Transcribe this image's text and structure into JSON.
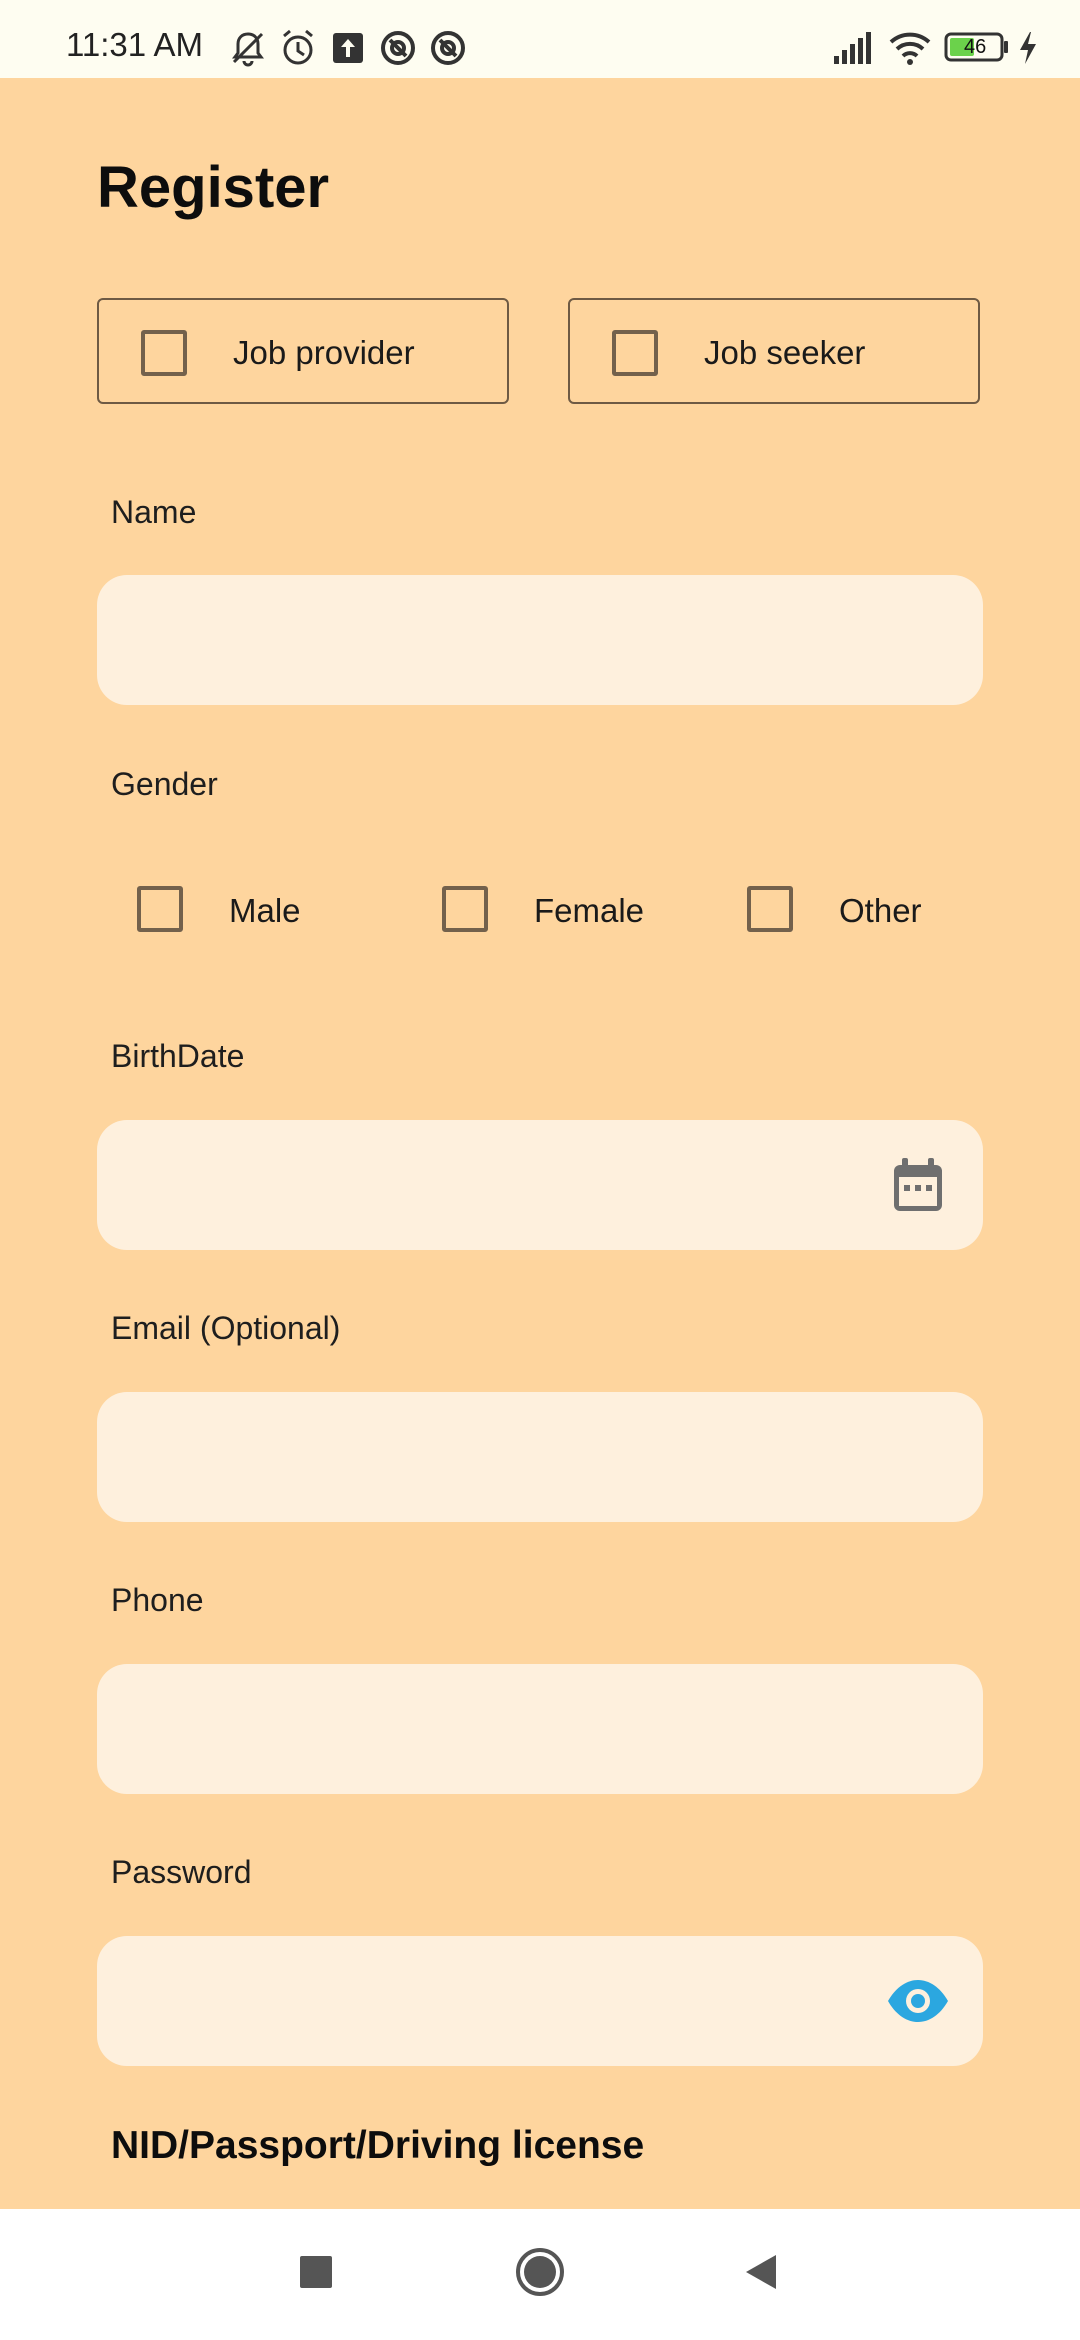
{
  "status_bar": {
    "time": "11:31 AM",
    "battery": "46",
    "icons_left": [
      "mute-notifications-icon",
      "alarm-icon",
      "upload-icon",
      "app-icon",
      "app-icon"
    ],
    "icons_right": [
      "signal-icon",
      "wifi-icon",
      "battery-icon",
      "charging-icon"
    ]
  },
  "page": {
    "title": "Register"
  },
  "roles": {
    "provider_label": "Job provider",
    "seeker_label": "Job seeker"
  },
  "form": {
    "name_label": "Name",
    "name_value": "",
    "gender_label": "Gender",
    "gender_options": [
      "Male",
      "Female",
      "Other"
    ],
    "birthdate_label": "BirthDate",
    "birthdate_value": "",
    "email_label": "Email (Optional)",
    "email_value": "",
    "phone_label": "Phone",
    "phone_value": "",
    "password_label": "Password",
    "password_value": "",
    "id_section_heading": "NID/Passport/Driving license"
  },
  "colors": {
    "background": "#FED59E",
    "input_fill": "#FEF0DD",
    "checkbox_border": "#73614C",
    "eye_icon": "#2BA7E0"
  },
  "nav_bar": {
    "buttons": [
      "recents-icon",
      "home-icon",
      "back-icon"
    ]
  }
}
